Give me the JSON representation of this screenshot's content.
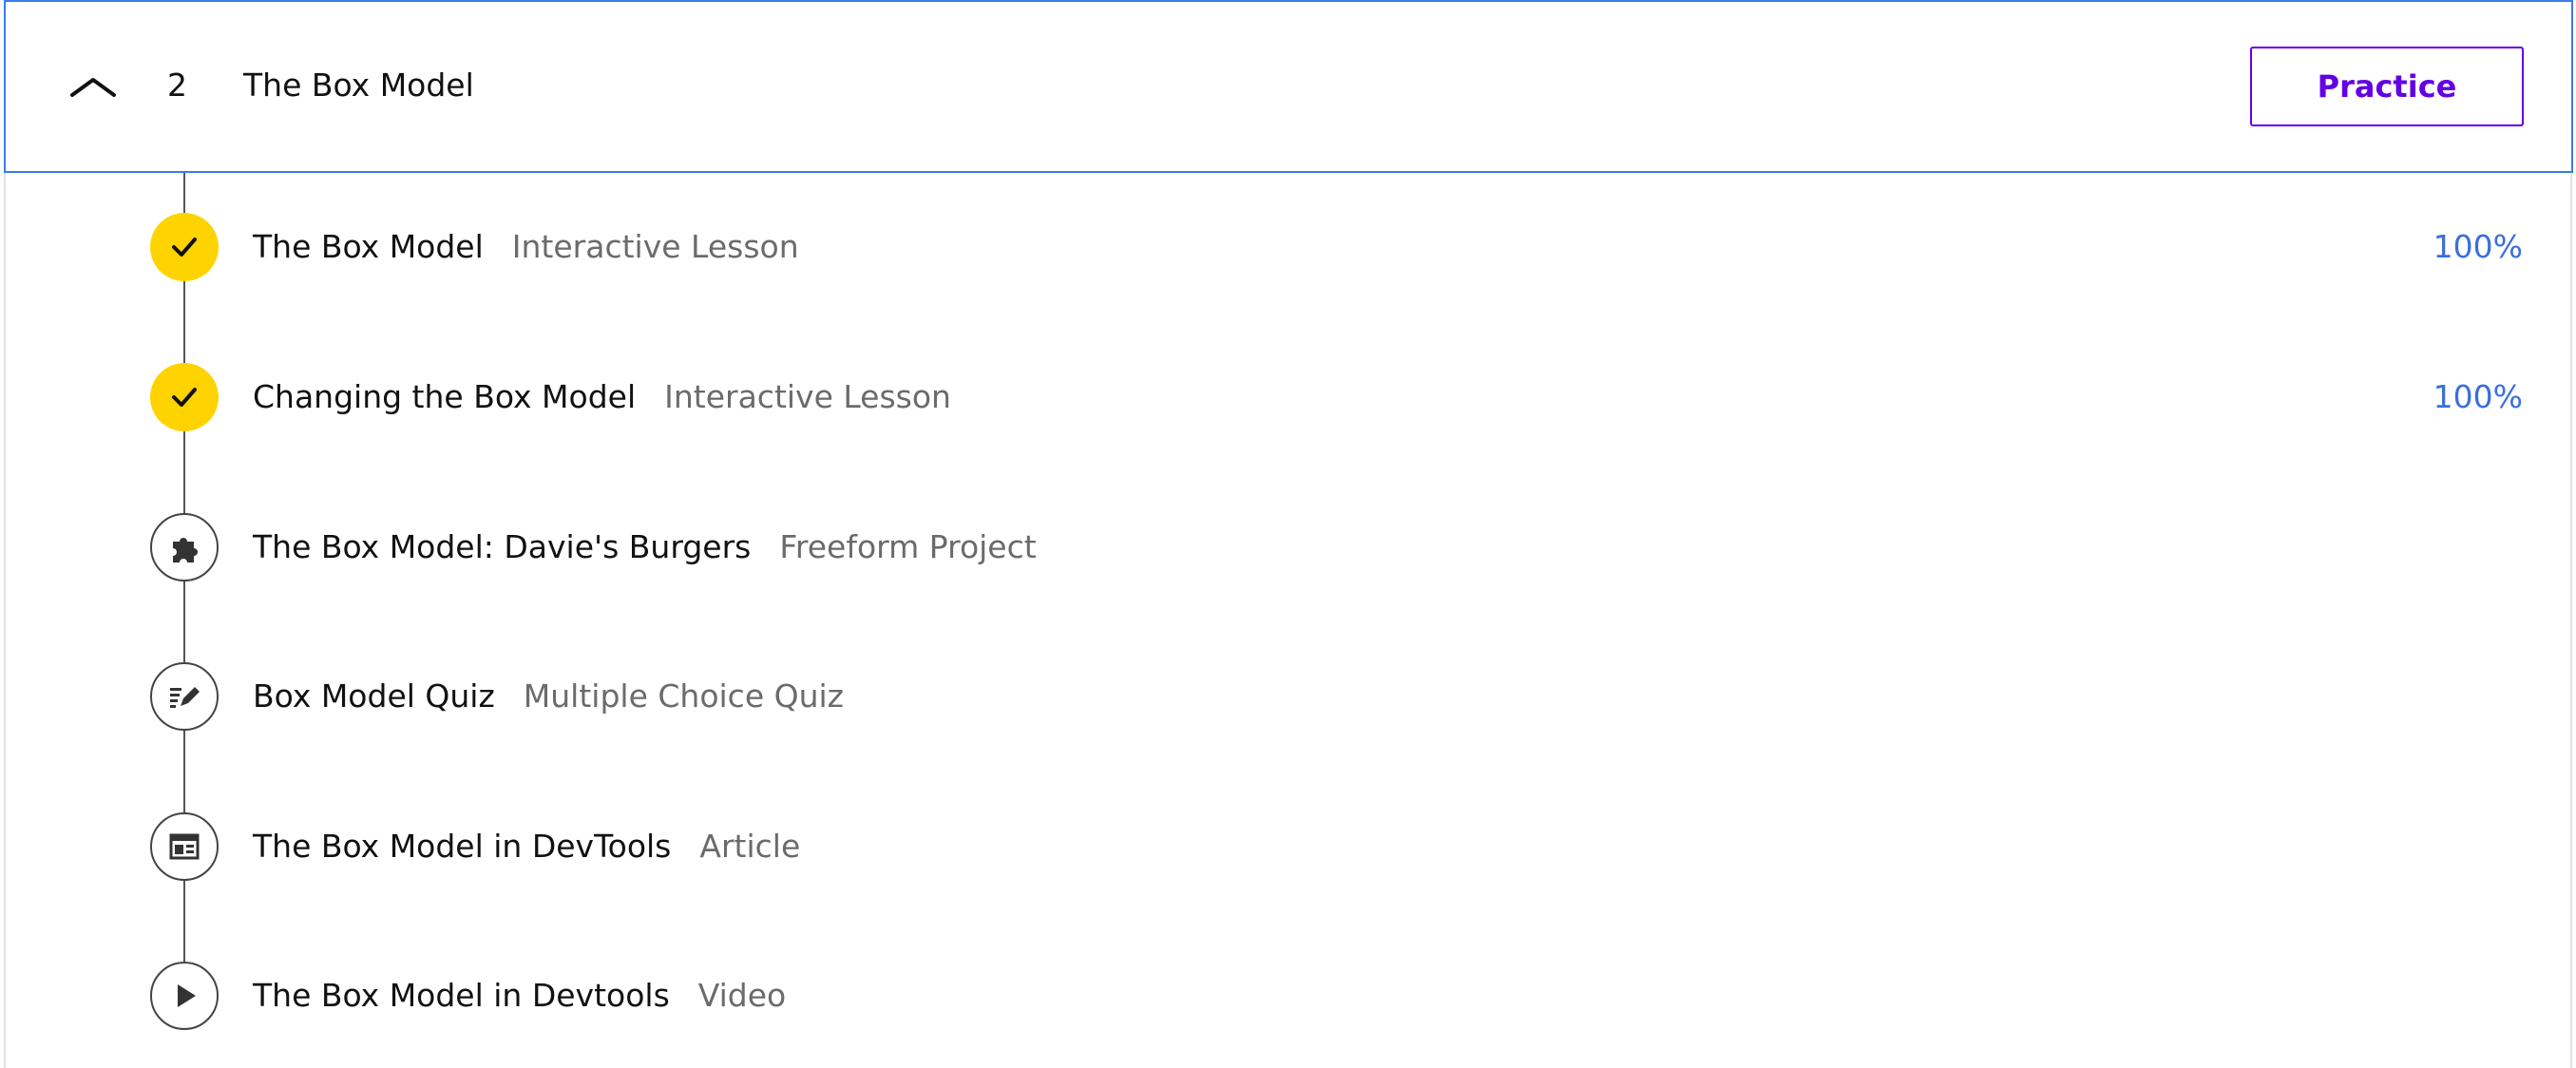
{
  "module": {
    "number": "2",
    "title": "The Box Model",
    "practice_label": "Practice",
    "chevron_icon": "chevron-up-icon",
    "accent_color": "#6400e4",
    "header_border_color": "#3a7bec"
  },
  "items": [
    {
      "title": "The Box Model",
      "type": "Interactive Lesson",
      "progress": "100%",
      "status": "complete",
      "icon": "check-icon"
    },
    {
      "title": "Changing the Box Model",
      "type": "Interactive Lesson",
      "progress": "100%",
      "status": "complete",
      "icon": "check-icon"
    },
    {
      "title": "The Box Model: Davie's Burgers",
      "type": "Freeform Project",
      "progress": "",
      "status": "incomplete",
      "icon": "puzzle-icon"
    },
    {
      "title": "Box Model Quiz",
      "type": "Multiple Choice Quiz",
      "progress": "",
      "status": "incomplete",
      "icon": "quiz-pencil-icon"
    },
    {
      "title": "The Box Model in DevTools",
      "type": "Article",
      "progress": "",
      "status": "incomplete",
      "icon": "article-icon"
    },
    {
      "title": "The Box Model in Devtools",
      "type": "Video",
      "progress": "",
      "status": "incomplete",
      "icon": "play-icon"
    }
  ],
  "colors": {
    "complete_node": "#ffd300",
    "progress_text": "#3a6fdc",
    "type_text": "#6b6b6b"
  }
}
